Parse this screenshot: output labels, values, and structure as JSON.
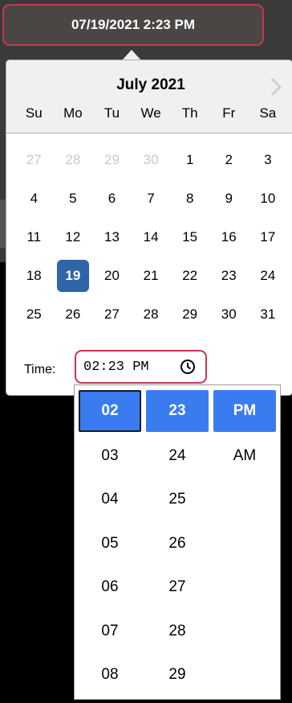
{
  "date_input": {
    "value": "07/19/2021 2:23 PM"
  },
  "calendar": {
    "month_title": "July 2021",
    "next_icon": "chevron-right-icon",
    "weekdays": [
      "Su",
      "Mo",
      "Tu",
      "We",
      "Th",
      "Fr",
      "Sa"
    ],
    "weeks": [
      [
        "27",
        "28",
        "29",
        "30",
        "1",
        "2",
        "3"
      ],
      [
        "4",
        "5",
        "6",
        "7",
        "8",
        "9",
        "10"
      ],
      [
        "11",
        "12",
        "13",
        "14",
        "15",
        "16",
        "17"
      ],
      [
        "18",
        "19",
        "20",
        "21",
        "22",
        "23",
        "24"
      ],
      [
        "25",
        "26",
        "27",
        "28",
        "29",
        "30",
        "31"
      ]
    ],
    "selected_day": "19",
    "outside_month_days": [
      "27",
      "28",
      "29",
      "30"
    ]
  },
  "time": {
    "label": "Time:",
    "value": "02:23 PM",
    "clock_icon": "clock-icon"
  },
  "time_picker": {
    "hours": [
      "02",
      "03",
      "04",
      "05",
      "06",
      "07",
      "08"
    ],
    "minutes": [
      "23",
      "24",
      "25",
      "26",
      "27",
      "28",
      "29"
    ],
    "periods": [
      "PM",
      "AM"
    ],
    "selected": {
      "hour": "02",
      "minute": "23",
      "period": "PM"
    }
  },
  "colors": {
    "selected_day_bg": "#2f64a8",
    "selected_option_bg": "#3a7cf0",
    "focus_border": "#c9364f",
    "header_bg": "#f0f0f0"
  }
}
